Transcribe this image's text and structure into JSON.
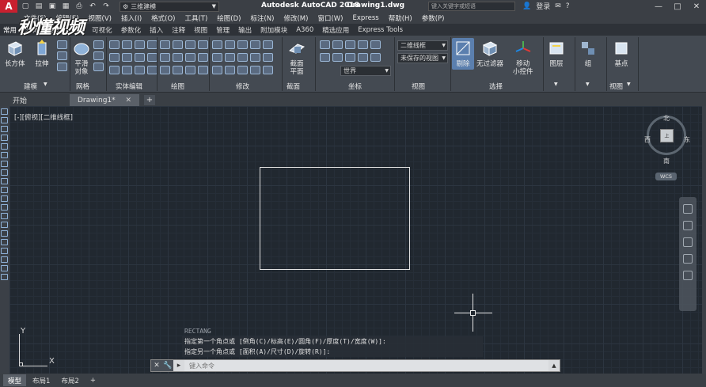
{
  "titlebar": {
    "app_logo": "A",
    "workspace": "三维建模",
    "app_title": "Autodesk AutoCAD 2018",
    "doc_title": "Drawing1.dwg",
    "search_placeholder": "键入关键字或短语",
    "login_label": "登录",
    "help_label": "?",
    "minimize": "—",
    "maximize": "□",
    "close": "✕"
  },
  "menu": [
    "文件(F)",
    "编辑(E)",
    "视图(V)",
    "插入(I)",
    "格式(O)",
    "工具(T)",
    "绘图(D)",
    "标注(N)",
    "修改(M)",
    "窗口(W)",
    "Express",
    "帮助(H)",
    "参数(P)"
  ],
  "ribbon_tabs": [
    "常用",
    "实体",
    "曲面",
    "网格",
    "可视化",
    "参数化",
    "插入",
    "注释",
    "视图",
    "管理",
    "输出",
    "附加模块",
    "A360",
    "精选应用",
    "Express Tools"
  ],
  "ribbon": {
    "buttons": {
      "box": "长方体",
      "extrude": "拉伸",
      "smooth": "平滑\n对象",
      "section_plane": "截面\n平面",
      "culling": "剔除",
      "no_filter": "无过滤器",
      "gizmo": "移动\n小控件",
      "layers": "图层",
      "groups": "组",
      "base_point": "基点"
    },
    "panels": {
      "modeling": "建模",
      "mesh": "网格",
      "solid_edit": "实体编辑",
      "draw": "绘图",
      "modify": "修改",
      "section": "截面",
      "coordinates": "坐标",
      "view": "视图",
      "selection": "选择",
      "view2": "视图"
    },
    "dropdowns": {
      "visual_style": "二维线框",
      "saved_view": "未保存的视图",
      "ucs": "世界"
    }
  },
  "doc_tabs": {
    "start": "开始",
    "current": "Drawing1*",
    "close": "✕",
    "add": "+"
  },
  "canvas": {
    "view_label": "[-][俯视][二维线框]",
    "viewcube": {
      "north": "北",
      "south": "南",
      "east": "东",
      "west": "西",
      "top": "上",
      "wcs": "WCS"
    },
    "ucs": {
      "x": "X",
      "y": "Y"
    }
  },
  "command": {
    "history": [
      "RECTANG",
      "指定第一个角点或 [倒角(C)/标高(E)/圆角(F)/厚度(T)/宽度(W)]:",
      "指定另一个角点或 [面积(A)/尺寸(D)/旋转(R)]:"
    ],
    "placeholder": "键入命令"
  },
  "layout_tabs": [
    "模型",
    "布局1",
    "布局2",
    "+"
  ],
  "watermark": "秒懂视频"
}
